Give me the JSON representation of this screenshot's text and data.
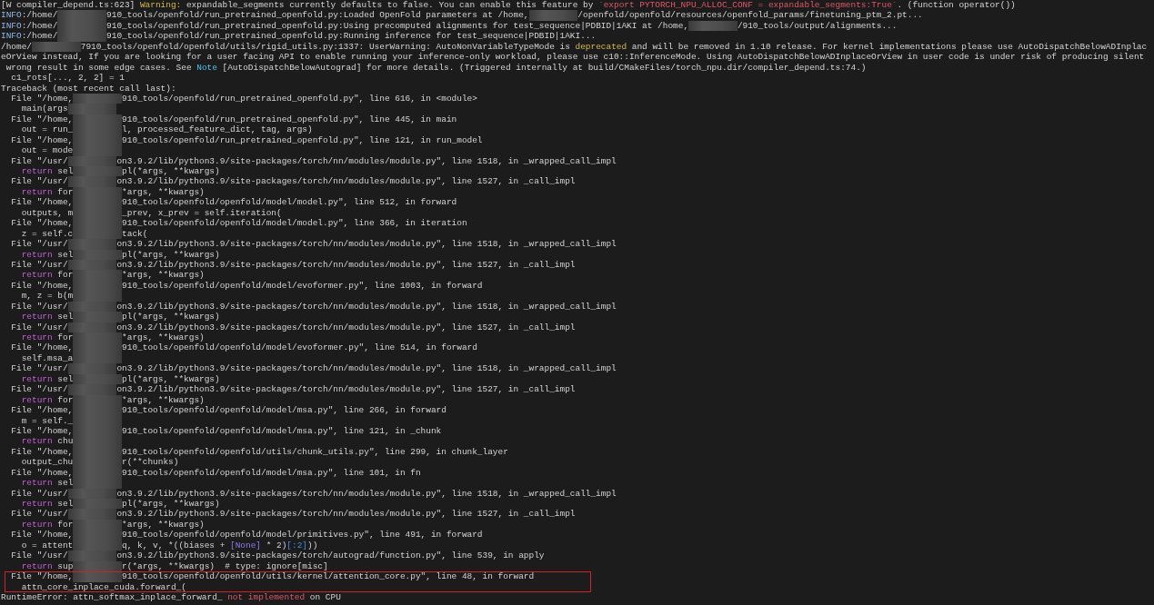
{
  "terminal": {
    "lines": [
      {
        "highlighted": false,
        "parts": [
          {
            "kind": "text",
            "text": "[W compiler_depend.ts:623] "
          },
          {
            "kind": "warn",
            "text": "Warning:"
          },
          {
            "kind": "text",
            "text": " expandable_segments currently defaults to false. You can enable this feature by "
          },
          {
            "kind": "alert",
            "text": "`export PYTORCH_NPU_ALLOC_CONF = expandable_segments:True`"
          },
          {
            "kind": "text",
            "text": ". (function operator())"
          }
        ]
      },
      {
        "highlighted": false,
        "parts": [
          {
            "kind": "info",
            "text": "INFO"
          },
          {
            "kind": "text",
            "text": ":/home/"
          },
          {
            "kind": "redacted"
          },
          {
            "kind": "text",
            "text": "910_tools/openfold/run_pretrained_openfold.py:Loaded OpenFold parameters at /home,"
          },
          {
            "kind": "redacted"
          },
          {
            "kind": "text",
            "text": "/openfold/openfold/resources/openfold_params/finetuning_ptm_2.pt..."
          }
        ]
      },
      {
        "highlighted": false,
        "parts": [
          {
            "kind": "info",
            "text": "INFO"
          },
          {
            "kind": "text",
            "text": ":/home/"
          },
          {
            "kind": "redacted"
          },
          {
            "kind": "text",
            "text": "910_tools/openfold/run_pretrained_openfold.py:Using precomputed alignments for test_sequence|PDBID|1AKI at /home,"
          },
          {
            "kind": "redacted"
          },
          {
            "kind": "text",
            "text": "/910_tools/output/alignments..."
          }
        ]
      },
      {
        "highlighted": false,
        "parts": [
          {
            "kind": "info",
            "text": "INFO"
          },
          {
            "kind": "text",
            "text": ":/home/"
          },
          {
            "kind": "redacted"
          },
          {
            "kind": "text",
            "text": "910_tools/openfold/run_pretrained_openfold.py:Running inference for test_sequence|PDBID|1AKI..."
          }
        ]
      },
      {
        "highlighted": false,
        "parts": [
          {
            "kind": "text",
            "text": "/home/"
          },
          {
            "kind": "redacted"
          },
          {
            "kind": "text",
            "text": "7910_tools/openfold/openfold/utils/rigid_utils.py:1337: UserWarning: AutoNonVariableTypeMode is "
          },
          {
            "kind": "warn",
            "text": "deprecated"
          },
          {
            "kind": "text",
            "text": " and will be removed in 1.10 release. For kernel implementations please use AutoDispatchBelowADInplac"
          }
        ]
      },
      {
        "highlighted": false,
        "parts": [
          {
            "kind": "text",
            "text": "eOrView instead, If you are looking for a user facing API to enable running your inference-only workload, please use c10::InferenceMode. Using AutoDispatchBelowADInplaceOrView in user code is under risk of producing silent"
          }
        ]
      },
      {
        "highlighted": false,
        "parts": [
          {
            "kind": "text",
            "text": " wrong result in some edge cases. See "
          },
          {
            "kind": "note",
            "text": "Note"
          },
          {
            "kind": "text",
            "text": " [AutoDispatchBelowAutograd] for more details. (Triggered internally at build/CMakeFiles/torch_npu.dir/compiler_depend.ts:74.)"
          }
        ]
      },
      {
        "highlighted": false,
        "parts": [
          {
            "kind": "text",
            "text": "  c1_rots[..., 2, 2] = 1"
          }
        ]
      },
      {
        "highlighted": false,
        "parts": [
          {
            "kind": "text",
            "text": "Traceback (most recent call last):"
          }
        ]
      },
      {
        "highlighted": false,
        "parts": [
          {
            "kind": "text",
            "text": "  File \"/home,"
          },
          {
            "kind": "redacted"
          },
          {
            "kind": "text",
            "text": "910_tools/openfold/run_pretrained_openfold.py\", line 616, in <module>"
          }
        ]
      },
      {
        "highlighted": false,
        "parts": [
          {
            "kind": "text",
            "text": "    main(args"
          },
          {
            "kind": "redacted"
          }
        ]
      },
      {
        "highlighted": false,
        "parts": [
          {
            "kind": "text",
            "text": "  File \"/home,"
          },
          {
            "kind": "redacted"
          },
          {
            "kind": "text",
            "text": "910_tools/openfold/run_pretrained_openfold.py\", line 445, in main"
          }
        ]
      },
      {
        "highlighted": false,
        "parts": [
          {
            "kind": "text",
            "text": "    out = run_"
          },
          {
            "kind": "redacted"
          },
          {
            "kind": "text",
            "text": "l, processed_feature_dict, tag, args)"
          }
        ]
      },
      {
        "highlighted": false,
        "parts": [
          {
            "kind": "text",
            "text": "  File \"/home,"
          },
          {
            "kind": "redacted"
          },
          {
            "kind": "text",
            "text": "910_tools/openfold/run_pretrained_openfold.py\", line 121, in run_model"
          }
        ]
      },
      {
        "highlighted": false,
        "parts": [
          {
            "kind": "text",
            "text": "    out = mode"
          },
          {
            "kind": "redacted"
          }
        ]
      },
      {
        "highlighted": false,
        "parts": [
          {
            "kind": "text",
            "text": "  File \"/usr/"
          },
          {
            "kind": "redacted"
          },
          {
            "kind": "text",
            "text": "on3.9.2/lib/python3.9/site-packages/torch/nn/modules/module.py\", line 1518, in _wrapped_call_impl"
          }
        ]
      },
      {
        "highlighted": false,
        "parts": [
          {
            "kind": "keyword",
            "text": "    return"
          },
          {
            "kind": "text",
            "text": " sel"
          },
          {
            "kind": "redacted"
          },
          {
            "kind": "text",
            "text": "pl(*args, **kwargs)"
          }
        ]
      },
      {
        "highlighted": false,
        "parts": [
          {
            "kind": "text",
            "text": "  File \"/usr/"
          },
          {
            "kind": "redacted"
          },
          {
            "kind": "text",
            "text": "on3.9.2/lib/python3.9/site-packages/torch/nn/modules/module.py\", line 1527, in _call_impl"
          }
        ]
      },
      {
        "highlighted": false,
        "parts": [
          {
            "kind": "keyword",
            "text": "    return"
          },
          {
            "kind": "text",
            "text": " for"
          },
          {
            "kind": "redacted"
          },
          {
            "kind": "text",
            "text": "*args, **kwargs)"
          }
        ]
      },
      {
        "highlighted": false,
        "parts": [
          {
            "kind": "text",
            "text": "  File \"/home,"
          },
          {
            "kind": "redacted"
          },
          {
            "kind": "text",
            "text": "910_tools/openfold/openfold/model/model.py\", line 512, in forward"
          }
        ]
      },
      {
        "highlighted": false,
        "parts": [
          {
            "kind": "text",
            "text": "    outputs, m"
          },
          {
            "kind": "redacted"
          },
          {
            "kind": "text",
            "text": "_prev, x_prev = self.iteration("
          }
        ]
      },
      {
        "highlighted": false,
        "parts": [
          {
            "kind": "text",
            "text": "  File \"/home,"
          },
          {
            "kind": "redacted"
          },
          {
            "kind": "text",
            "text": "910_tools/openfold/openfold/model/model.py\", line 366, in iteration"
          }
        ]
      },
      {
        "highlighted": false,
        "parts": [
          {
            "kind": "text",
            "text": "    z = self.c"
          },
          {
            "kind": "redacted"
          },
          {
            "kind": "text",
            "text": "tack("
          }
        ]
      },
      {
        "highlighted": false,
        "parts": [
          {
            "kind": "text",
            "text": "  File \"/usr/"
          },
          {
            "kind": "redacted"
          },
          {
            "kind": "text",
            "text": "on3.9.2/lib/python3.9/site-packages/torch/nn/modules/module.py\", line 1518, in _wrapped_call_impl"
          }
        ]
      },
      {
        "highlighted": false,
        "parts": [
          {
            "kind": "keyword",
            "text": "    return"
          },
          {
            "kind": "text",
            "text": " sel"
          },
          {
            "kind": "redacted"
          },
          {
            "kind": "text",
            "text": "pl(*args, **kwargs)"
          }
        ]
      },
      {
        "highlighted": false,
        "parts": [
          {
            "kind": "text",
            "text": "  File \"/usr/"
          },
          {
            "kind": "redacted"
          },
          {
            "kind": "text",
            "text": "on3.9.2/lib/python3.9/site-packages/torch/nn/modules/module.py\", line 1527, in _call_impl"
          }
        ]
      },
      {
        "highlighted": false,
        "parts": [
          {
            "kind": "keyword",
            "text": "    return"
          },
          {
            "kind": "text",
            "text": " for"
          },
          {
            "kind": "redacted"
          },
          {
            "kind": "text",
            "text": "*args, **kwargs)"
          }
        ]
      },
      {
        "highlighted": false,
        "parts": [
          {
            "kind": "text",
            "text": "  File \"/home,"
          },
          {
            "kind": "redacted"
          },
          {
            "kind": "text",
            "text": "910_tools/openfold/openfold/model/evoformer.py\", line 1003, in forward"
          }
        ]
      },
      {
        "highlighted": false,
        "parts": [
          {
            "kind": "text",
            "text": "    m, z = b(m"
          },
          {
            "kind": "redacted"
          }
        ]
      },
      {
        "highlighted": false,
        "parts": [
          {
            "kind": "text",
            "text": "  File \"/usr/"
          },
          {
            "kind": "redacted"
          },
          {
            "kind": "text",
            "text": "on3.9.2/lib/python3.9/site-packages/torch/nn/modules/module.py\", line 1518, in _wrapped_call_impl"
          }
        ]
      },
      {
        "highlighted": false,
        "parts": [
          {
            "kind": "keyword",
            "text": "    return"
          },
          {
            "kind": "text",
            "text": " sel"
          },
          {
            "kind": "redacted"
          },
          {
            "kind": "text",
            "text": "pl(*args, **kwargs)"
          }
        ]
      },
      {
        "highlighted": false,
        "parts": [
          {
            "kind": "text",
            "text": "  File \"/usr/"
          },
          {
            "kind": "redacted"
          },
          {
            "kind": "text",
            "text": "on3.9.2/lib/python3.9/site-packages/torch/nn/modules/module.py\", line 1527, in _call_impl"
          }
        ]
      },
      {
        "highlighted": false,
        "parts": [
          {
            "kind": "keyword",
            "text": "    return"
          },
          {
            "kind": "text",
            "text": " for"
          },
          {
            "kind": "redacted"
          },
          {
            "kind": "text",
            "text": "*args, **kwargs)"
          }
        ]
      },
      {
        "highlighted": false,
        "parts": [
          {
            "kind": "text",
            "text": "  File \"/home,"
          },
          {
            "kind": "redacted"
          },
          {
            "kind": "text",
            "text": "910_tools/openfold/openfold/model/evoformer.py\", line 514, in forward"
          }
        ]
      },
      {
        "highlighted": false,
        "parts": [
          {
            "kind": "text",
            "text": "    self.msa_a"
          },
          {
            "kind": "redacted"
          }
        ]
      },
      {
        "highlighted": false,
        "parts": [
          {
            "kind": "text",
            "text": "  File \"/usr/"
          },
          {
            "kind": "redacted"
          },
          {
            "kind": "text",
            "text": "on3.9.2/lib/python3.9/site-packages/torch/nn/modules/module.py\", line 1518, in _wrapped_call_impl"
          }
        ]
      },
      {
        "highlighted": false,
        "parts": [
          {
            "kind": "keyword",
            "text": "    return"
          },
          {
            "kind": "text",
            "text": " sel"
          },
          {
            "kind": "redacted"
          },
          {
            "kind": "text",
            "text": "pl(*args, **kwargs)"
          }
        ]
      },
      {
        "highlighted": false,
        "parts": [
          {
            "kind": "text",
            "text": "  File \"/usr/"
          },
          {
            "kind": "redacted"
          },
          {
            "kind": "text",
            "text": "on3.9.2/lib/python3.9/site-packages/torch/nn/modules/module.py\", line 1527, in _call_impl"
          }
        ]
      },
      {
        "highlighted": false,
        "parts": [
          {
            "kind": "keyword",
            "text": "    return"
          },
          {
            "kind": "text",
            "text": " for"
          },
          {
            "kind": "redacted"
          },
          {
            "kind": "text",
            "text": "*args, **kwargs)"
          }
        ]
      },
      {
        "highlighted": false,
        "parts": [
          {
            "kind": "text",
            "text": "  File \"/home,"
          },
          {
            "kind": "redacted"
          },
          {
            "kind": "text",
            "text": "910_tools/openfold/openfold/model/msa.py\", line 266, in forward"
          }
        ]
      },
      {
        "highlighted": false,
        "parts": [
          {
            "kind": "text",
            "text": "    m = self._"
          },
          {
            "kind": "redacted"
          }
        ]
      },
      {
        "highlighted": false,
        "parts": [
          {
            "kind": "text",
            "text": "  File \"/home,"
          },
          {
            "kind": "redacted"
          },
          {
            "kind": "text",
            "text": "910_tools/openfold/openfold/model/msa.py\", line 121, in _chunk"
          }
        ]
      },
      {
        "highlighted": false,
        "parts": [
          {
            "kind": "keyword",
            "text": "    return"
          },
          {
            "kind": "text",
            "text": " chu"
          },
          {
            "kind": "redacted"
          }
        ]
      },
      {
        "highlighted": false,
        "parts": [
          {
            "kind": "text",
            "text": "  File \"/home,"
          },
          {
            "kind": "redacted"
          },
          {
            "kind": "text",
            "text": "910_tools/openfold/openfold/utils/chunk_utils.py\", line 299, in chunk_layer"
          }
        ]
      },
      {
        "highlighted": false,
        "parts": [
          {
            "kind": "text",
            "text": "    output_chu"
          },
          {
            "kind": "redacted"
          },
          {
            "kind": "text",
            "text": "r(**chunks)"
          }
        ]
      },
      {
        "highlighted": false,
        "parts": [
          {
            "kind": "text",
            "text": "  File \"/home,"
          },
          {
            "kind": "redacted"
          },
          {
            "kind": "text",
            "text": "910_tools/openfold/openfold/model/msa.py\", line 101, in fn"
          }
        ]
      },
      {
        "highlighted": false,
        "parts": [
          {
            "kind": "keyword",
            "text": "    return"
          },
          {
            "kind": "text",
            "text": " sel"
          },
          {
            "kind": "redacted"
          }
        ]
      },
      {
        "highlighted": false,
        "parts": [
          {
            "kind": "text",
            "text": "  File \"/usr/"
          },
          {
            "kind": "redacted"
          },
          {
            "kind": "text",
            "text": "on3.9.2/lib/python3.9/site-packages/torch/nn/modules/module.py\", line 1518, in _wrapped_call_impl"
          }
        ]
      },
      {
        "highlighted": false,
        "parts": [
          {
            "kind": "keyword",
            "text": "    return"
          },
          {
            "kind": "text",
            "text": " sel"
          },
          {
            "kind": "redacted"
          },
          {
            "kind": "text",
            "text": "pl(*args, **kwargs)"
          }
        ]
      },
      {
        "highlighted": false,
        "parts": [
          {
            "kind": "text",
            "text": "  File \"/usr/"
          },
          {
            "kind": "redacted"
          },
          {
            "kind": "text",
            "text": "on3.9.2/lib/python3.9/site-packages/torch/nn/modules/module.py\", line 1527, in _call_impl"
          }
        ]
      },
      {
        "highlighted": false,
        "parts": [
          {
            "kind": "keyword",
            "text": "    return"
          },
          {
            "kind": "text",
            "text": " for"
          },
          {
            "kind": "redacted"
          },
          {
            "kind": "text",
            "text": "*args, **kwargs)"
          }
        ]
      },
      {
        "highlighted": false,
        "parts": [
          {
            "kind": "text",
            "text": "  File \"/home,"
          },
          {
            "kind": "redacted"
          },
          {
            "kind": "text",
            "text": "910_tools/openfold/openfold/model/primitives.py\", line 491, in forward"
          }
        ]
      },
      {
        "highlighted": false,
        "parts": [
          {
            "kind": "text",
            "text": "    o = attent"
          },
          {
            "kind": "redacted"
          },
          {
            "kind": "text",
            "text": "q, k, v, *((biases + "
          },
          {
            "kind": "constant",
            "text": "[None]"
          },
          {
            "kind": "text",
            "text": " * 2)"
          },
          {
            "kind": "slice",
            "text": "[:2]"
          },
          {
            "kind": "text",
            "text": "))"
          }
        ]
      },
      {
        "highlighted": false,
        "parts": [
          {
            "kind": "text",
            "text": "  File \"/usr/"
          },
          {
            "kind": "redacted"
          },
          {
            "kind": "text",
            "text": "on3.9.2/lib/python3.9/site-packages/torch/autograd/function.py\", line 539, in apply"
          }
        ]
      },
      {
        "highlighted": false,
        "parts": [
          {
            "kind": "keyword",
            "text": "    return"
          },
          {
            "kind": "text",
            "text": " sup"
          },
          {
            "kind": "redacted"
          },
          {
            "kind": "text",
            "text": "r(*args, **kwargs)  # type: ignore[misc]"
          }
        ]
      },
      {
        "highlighted": true,
        "parts": [
          {
            "kind": "text",
            "text": "  File \"/home,"
          },
          {
            "kind": "redacted"
          },
          {
            "kind": "text",
            "text": "910_tools/openfold/openfold/utils/kernel/attention_core.py\", line 48, in forward"
          }
        ]
      },
      {
        "highlighted": true,
        "parts": [
          {
            "kind": "text",
            "text": "    attn_core_inplace_cuda.forward_("
          }
        ]
      },
      {
        "highlighted": false,
        "parts": [
          {
            "kind": "text",
            "text": "RuntimeError: attn_softmax_inplace_forward_ "
          },
          {
            "kind": "alert",
            "text": "not implemented"
          },
          {
            "kind": "text",
            "text": " on CPU"
          }
        ]
      }
    ]
  }
}
